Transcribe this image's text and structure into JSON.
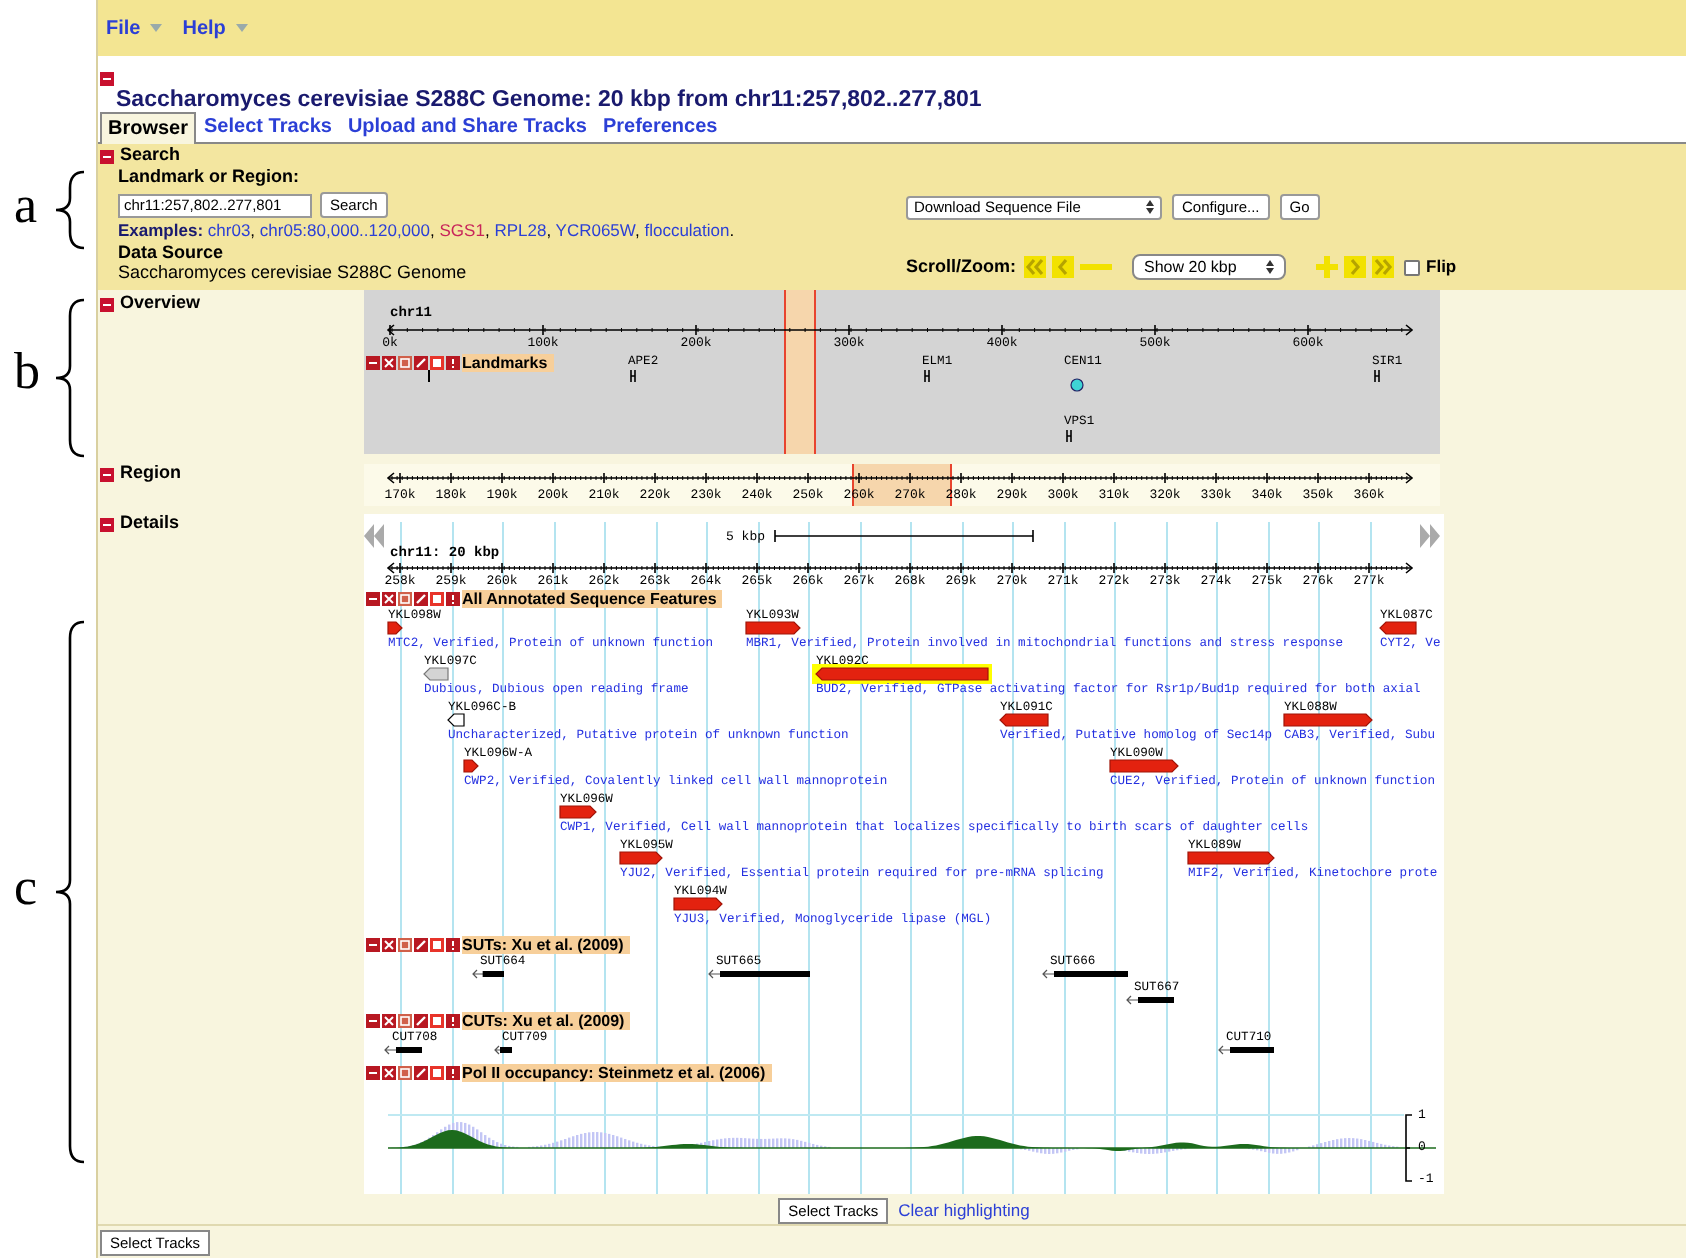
{
  "annotations": [
    {
      "letter": "a"
    },
    {
      "letter": "b"
    },
    {
      "letter": "c"
    }
  ],
  "menu": [
    {
      "label": "File"
    },
    {
      "label": "Help"
    }
  ],
  "title": "Saccharomyces cerevisiae S288C Genome: 20 kbp from chr11:257,802..277,801",
  "tabs": [
    {
      "label": "Browser",
      "selected": true
    },
    {
      "label": "Select Tracks",
      "selected": false
    },
    {
      "label": "Upload and Share Tracks",
      "selected": false
    },
    {
      "label": "Preferences",
      "selected": false
    }
  ],
  "search": {
    "heading": "Search",
    "landmark_label": "Landmark or Region:",
    "value": "chr11:257,802..277,801",
    "button": "Search",
    "examples_label": "Examples:",
    "examples": [
      {
        "text": "chr03",
        "visited": false,
        "after": ","
      },
      {
        "text": "chr05:80,000..120,000",
        "visited": false,
        "after": ","
      },
      {
        "text": "SGS1",
        "visited": true,
        "after": ","
      },
      {
        "text": "RPL28",
        "visited": false,
        "after": ","
      },
      {
        "text": "YCR065W",
        "visited": false,
        "after": ","
      },
      {
        "text": "flocculation",
        "visited": false,
        "after": "."
      }
    ],
    "data_source_label": "Data Source",
    "data_source": "Saccharomyces cerevisiae S288C Genome",
    "download_select": "Download Sequence File",
    "configure_button": "Configure...",
    "go_button": "Go",
    "scroll_zoom_label": "Scroll/Zoom:",
    "zoom_select": "Show 20 kbp",
    "flip": {
      "label": "Flip",
      "checked": false
    }
  },
  "overview": {
    "label": "Overview",
    "chromosome": "chr11",
    "ticks": [
      "0k",
      "100k",
      "200k",
      "300k",
      "400k",
      "500k",
      "600k"
    ],
    "track": "Landmarks",
    "landmarks": [
      {
        "label": "APE2",
        "kind": "gene"
      },
      {
        "label": "ELM1",
        "kind": "gene"
      },
      {
        "label": "CEN11",
        "kind": "centromere"
      },
      {
        "label": "SIR1",
        "kind": "gene"
      },
      {
        "label": "VPS1",
        "kind": "gene"
      }
    ]
  },
  "region": {
    "label": "Region",
    "ticks": [
      "170k",
      "180k",
      "190k",
      "200k",
      "210k",
      "220k",
      "230k",
      "240k",
      "250k",
      "260k",
      "270k",
      "280k",
      "290k",
      "300k",
      "310k",
      "320k",
      "330k",
      "340k",
      "350k",
      "360k"
    ]
  },
  "details": {
    "label": "Details",
    "scale": "5 kbp",
    "ruler_title": "chr11: 20 kbp",
    "ticks": [
      "258k",
      "259k",
      "260k",
      "261k",
      "262k",
      "263k",
      "264k",
      "265k",
      "266k",
      "267k",
      "268k",
      "269k",
      "270k",
      "271k",
      "272k",
      "273k",
      "274k",
      "275k",
      "276k",
      "277k"
    ],
    "tracks": [
      {
        "title": "All Annotated Sequence Features",
        "kind": "genes",
        "features": [
          {
            "name": "YKL098W",
            "description": "MTC2, Verified, Protein of unknown function",
            "reverse": false,
            "kind": "verified",
            "highlighted": false
          },
          {
            "name": "YKL093W",
            "description": "MBR1, Verified, Protein involved in mitochondrial functions and stress response",
            "reverse": false,
            "kind": "verified",
            "highlighted": false
          },
          {
            "name": "YKL087C",
            "description": "CYT2, Ve",
            "reverse": true,
            "kind": "verified",
            "highlighted": false
          },
          {
            "name": "YKL097C",
            "description": "Dubious, Dubious open reading frame",
            "reverse": true,
            "kind": "dubious",
            "highlighted": false
          },
          {
            "name": "YKL092C",
            "description": "BUD2, Verified, GTPase activating factor for Rsr1p/Bud1p required for both axial",
            "reverse": true,
            "kind": "verified",
            "highlighted": true
          },
          {
            "name": "YKL096C-B",
            "description": "Uncharacterized, Putative protein of unknown function",
            "reverse": true,
            "kind": "uncharacterized",
            "highlighted": false
          },
          {
            "name": "YKL091C",
            "description": "Verified, Putative homolog of Sec14p",
            "reverse": true,
            "kind": "verified",
            "highlighted": false
          },
          {
            "name": "YKL088W",
            "description": "CAB3, Verified, Subu",
            "reverse": false,
            "kind": "verified",
            "highlighted": false
          },
          {
            "name": "YKL096W-A",
            "description": "CWP2, Verified, Covalently linked cell wall mannoprotein",
            "reverse": false,
            "kind": "verified",
            "highlighted": false
          },
          {
            "name": "YKL090W",
            "description": "CUE2, Verified, Protein of unknown function",
            "reverse": false,
            "kind": "verified",
            "highlighted": false
          },
          {
            "name": "YKL096W",
            "description": "CWP1, Verified, Cell wall mannoprotein that localizes specifically to birth scars of daughter cells",
            "reverse": false,
            "kind": "verified",
            "highlighted": false
          },
          {
            "name": "YKL095W",
            "description": "YJU2, Verified, Essential protein required for pre-mRNA splicing",
            "reverse": false,
            "kind": "verified",
            "highlighted": false
          },
          {
            "name": "YKL089W",
            "description": "MIF2, Verified, Kinetochore prote",
            "reverse": false,
            "kind": "verified",
            "highlighted": false
          },
          {
            "name": "YKL094W",
            "description": "YJU3, Verified, Monoglyceride lipase (MGL)",
            "reverse": false,
            "kind": "verified",
            "highlighted": false
          }
        ]
      },
      {
        "title": "SUTs: Xu et al. (2009)",
        "kind": "transcripts",
        "features": [
          {
            "name": "SUT664"
          },
          {
            "name": "SUT665"
          },
          {
            "name": "SUT666"
          },
          {
            "name": "SUT667"
          }
        ]
      },
      {
        "title": "CUTs: Xu et al. (2009)",
        "kind": "transcripts",
        "features": [
          {
            "name": "CUT708"
          },
          {
            "name": "CUT709"
          },
          {
            "name": "CUT710"
          }
        ]
      },
      {
        "title": "Pol II occupancy: Steinmetz et al. (2006)",
        "kind": "wiggle",
        "axis_labels": [
          "1",
          "0",
          "-1"
        ]
      }
    ]
  },
  "bottom_buttons": {
    "select_tracks": "Select Tracks",
    "clear": "Clear highlighting"
  },
  "footer_button": "Select Tracks"
}
